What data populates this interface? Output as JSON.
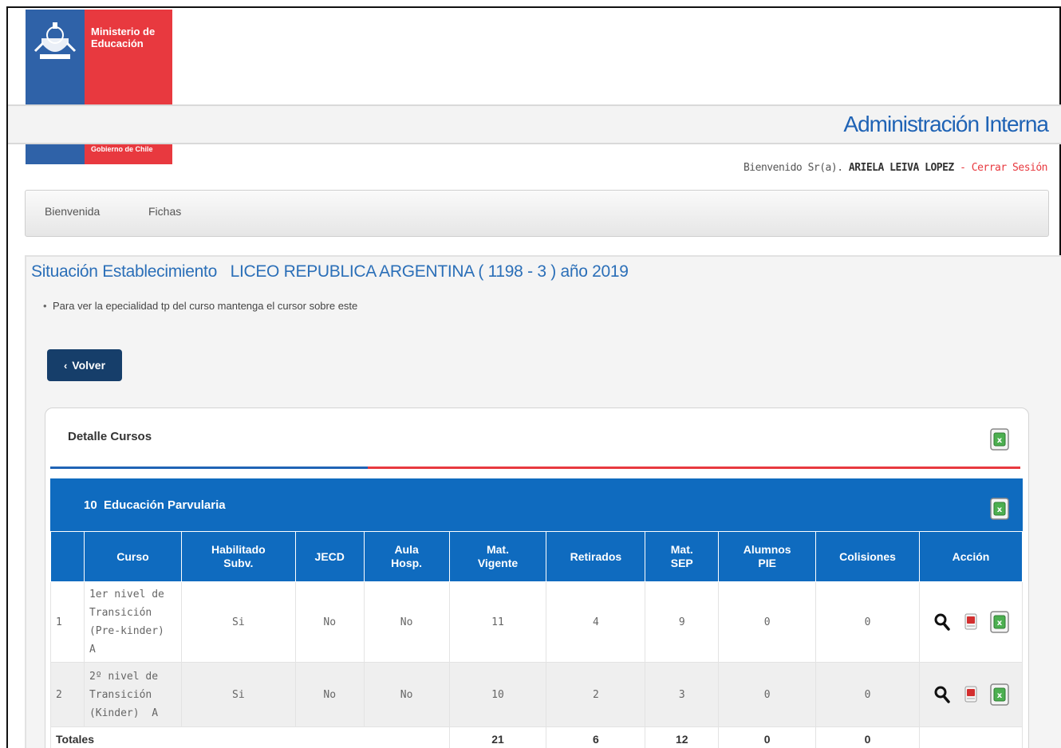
{
  "logo": {
    "title_line1": "Ministerio de",
    "title_line2": "Educación",
    "subtitle": "Gobierno de Chile"
  },
  "header": {
    "app_title": "Administración Interna",
    "welcome_prefix": "Bienvenido Sr(a).",
    "user_name": "ARIELA LEIVA LOPEZ",
    "separator": "-",
    "logout_label": "Cerrar Sesión"
  },
  "nav": {
    "items": [
      {
        "label": "Bienvenida"
      },
      {
        "label": "Fichas"
      }
    ]
  },
  "page": {
    "heading": "Situación Establecimiento   LICEO REPUBLICA ARGENTINA ( 1198 - 3 ) año 2019",
    "hint": "Para ver la epecialidad tp del curso mantenga el cursor sobre este",
    "back_label": "Volver"
  },
  "card": {
    "title": "Detalle Cursos",
    "section_title": "10  Educación Parvularia"
  },
  "table": {
    "headers": {
      "num": "",
      "curso": "Curso",
      "habilitado_1": "Habilitado",
      "habilitado_2": "Subv.",
      "jecd": "JECD",
      "aula_1": "Aula",
      "aula_2": "Hosp.",
      "mat_1": "Mat.",
      "mat_2": "Vigente",
      "retirados": "Retirados",
      "sep_1": "Mat.",
      "sep_2": "SEP",
      "pie_1": "Alumnos",
      "pie_2": "PIE",
      "colisiones": "Colisiones",
      "accion": "Acción"
    },
    "rows": [
      {
        "num": "1",
        "curso_lines": [
          "1er nivel de",
          "Transición",
          "(Pre-kinder)",
          "A"
        ],
        "habilitado": "Si",
        "jecd": "No",
        "aula": "No",
        "mat_vigente": "11",
        "retirados": "4",
        "mat_sep": "9",
        "pie": "0",
        "colisiones": "0"
      },
      {
        "num": "2",
        "curso_lines": [
          "2º nivel de",
          "Transición",
          "(Kinder)  A"
        ],
        "habilitado": "Si",
        "jecd": "No",
        "aula": "No",
        "mat_vigente": "10",
        "retirados": "2",
        "mat_sep": "3",
        "pie": "0",
        "colisiones": "0"
      }
    ],
    "totals": {
      "label": "Totales",
      "mat_vigente": "21",
      "retirados": "6",
      "mat_sep": "12",
      "pie": "0",
      "colisiones": "0"
    }
  },
  "colors": {
    "brand_blue": "#1f63b5",
    "bar_blue": "#0f6bbf",
    "brand_red": "#e8393f",
    "btn_navy": "#163e6a"
  },
  "icons": {
    "excel": "excel-icon",
    "search": "search-icon",
    "pdf": "pdf-icon",
    "back": "chevron-left-icon"
  }
}
